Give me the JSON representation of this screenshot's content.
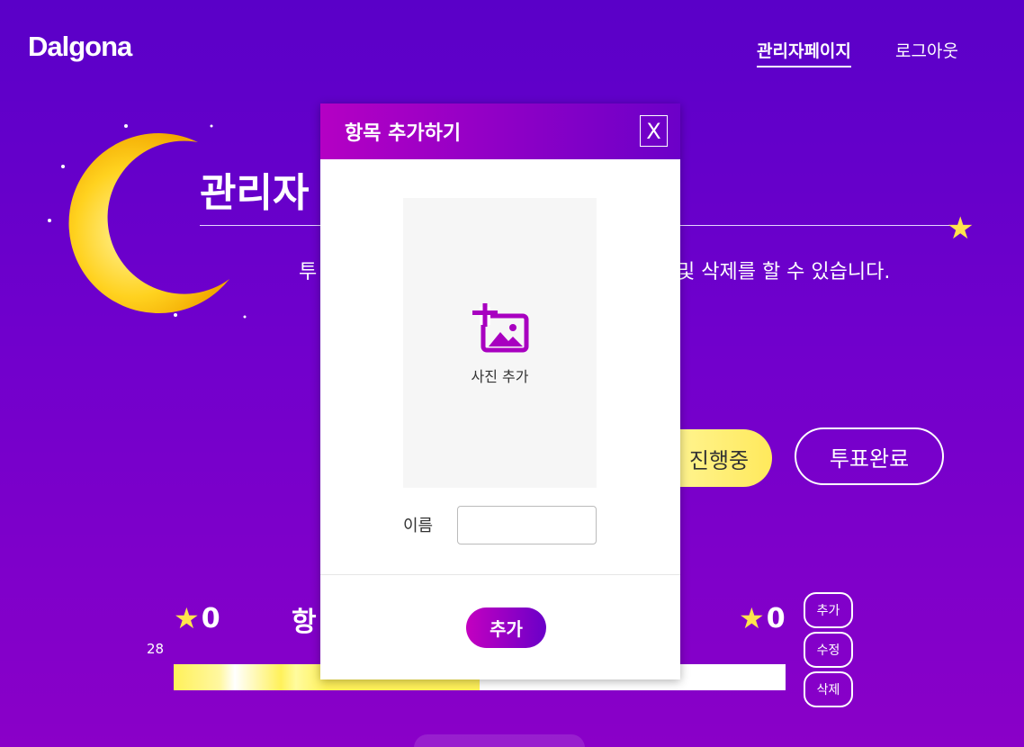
{
  "header": {
    "logo": "Dalgona",
    "nav_admin": "관리자페이지",
    "nav_logout": "로그아웃"
  },
  "page": {
    "heading": "관리자",
    "desc_left": "투",
    "desc_right": "및 삭제를 할 수 있습니다.",
    "status_ongoing": "진행중",
    "status_done": "투표완료"
  },
  "vote": {
    "left_count": "0",
    "right_count": "0",
    "item_label": "항",
    "side_value": "28",
    "progress_fraction": 0.5,
    "side_buttons": {
      "add": "추가",
      "edit": "수정",
      "delete": "삭제"
    }
  },
  "modal": {
    "title": "항목 추가하기",
    "close": "X",
    "photo_label": "사진 추가",
    "name_label": "이름",
    "name_value": "",
    "submit": "추가"
  },
  "colors": {
    "accent_purple": "#8a00c8",
    "modal_gradient_start": "#b400c4",
    "moon_yellow": "#ffd21f"
  },
  "icons": {
    "photo": "add-photo-icon",
    "star": "star-icon",
    "moon": "moon-icon"
  }
}
